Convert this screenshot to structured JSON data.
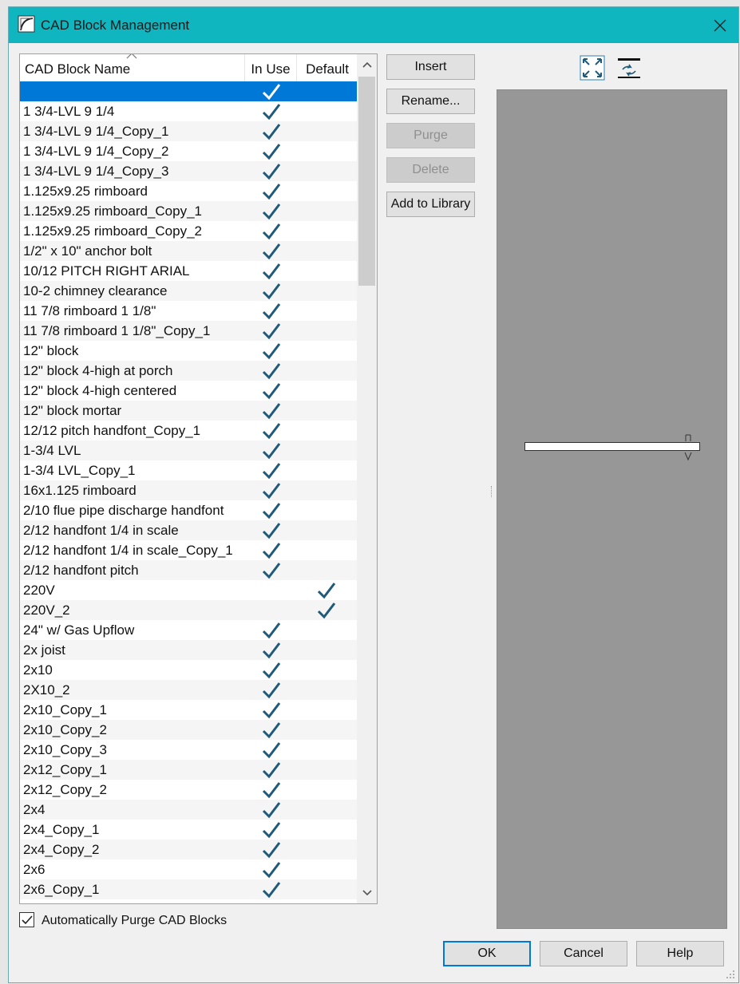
{
  "window": {
    "title": "CAD Block Management"
  },
  "columns": {
    "name": "CAD Block Name",
    "in_use": "In Use",
    "default": "Default"
  },
  "rows": [
    {
      "name": "",
      "in_use": true,
      "default": false,
      "selected": true
    },
    {
      "name": "1 3/4-LVL 9 1/4",
      "in_use": true,
      "default": false
    },
    {
      "name": "1 3/4-LVL 9 1/4_Copy_1",
      "in_use": true,
      "default": false
    },
    {
      "name": "1 3/4-LVL 9 1/4_Copy_2",
      "in_use": true,
      "default": false
    },
    {
      "name": "1 3/4-LVL 9 1/4_Copy_3",
      "in_use": true,
      "default": false
    },
    {
      "name": "1.125x9.25 rimboard",
      "in_use": true,
      "default": false
    },
    {
      "name": "1.125x9.25 rimboard_Copy_1",
      "in_use": true,
      "default": false
    },
    {
      "name": "1.125x9.25 rimboard_Copy_2",
      "in_use": true,
      "default": false
    },
    {
      "name": "1/2\" x 10\" anchor bolt",
      "in_use": true,
      "default": false
    },
    {
      "name": "10/12 PITCH RIGHT ARIAL",
      "in_use": true,
      "default": false
    },
    {
      "name": "10-2 chimney clearance",
      "in_use": true,
      "default": false
    },
    {
      "name": "11 7/8 rimboard 1 1/8\"",
      "in_use": true,
      "default": false
    },
    {
      "name": "11 7/8 rimboard 1 1/8\"_Copy_1",
      "in_use": true,
      "default": false
    },
    {
      "name": "12\" block",
      "in_use": true,
      "default": false
    },
    {
      "name": "12\" block 4-high at porch",
      "in_use": true,
      "default": false
    },
    {
      "name": "12\" block 4-high centered",
      "in_use": true,
      "default": false
    },
    {
      "name": "12\" block mortar",
      "in_use": true,
      "default": false
    },
    {
      "name": "12/12 pitch handfont_Copy_1",
      "in_use": true,
      "default": false
    },
    {
      "name": "1-3/4 LVL",
      "in_use": true,
      "default": false
    },
    {
      "name": "1-3/4 LVL_Copy_1",
      "in_use": true,
      "default": false
    },
    {
      "name": "16x1.125 rimboard",
      "in_use": true,
      "default": false
    },
    {
      "name": "2/10 flue pipe discharge handfont",
      "in_use": true,
      "default": false
    },
    {
      "name": "2/12 handfont 1/4 in scale",
      "in_use": true,
      "default": false
    },
    {
      "name": "2/12 handfont 1/4 in scale_Copy_1",
      "in_use": true,
      "default": false
    },
    {
      "name": "2/12 handfont pitch",
      "in_use": true,
      "default": false
    },
    {
      "name": "220V",
      "in_use": false,
      "default": true
    },
    {
      "name": "220V_2",
      "in_use": false,
      "default": true
    },
    {
      "name": "24\" w/ Gas Upflow",
      "in_use": true,
      "default": false
    },
    {
      "name": "2x joist",
      "in_use": true,
      "default": false
    },
    {
      "name": "2x10",
      "in_use": true,
      "default": false
    },
    {
      "name": "2X10_2",
      "in_use": true,
      "default": false
    },
    {
      "name": "2x10_Copy_1",
      "in_use": true,
      "default": false
    },
    {
      "name": "2x10_Copy_2",
      "in_use": true,
      "default": false
    },
    {
      "name": "2x10_Copy_3",
      "in_use": true,
      "default": false
    },
    {
      "name": "2x12_Copy_1",
      "in_use": true,
      "default": false
    },
    {
      "name": "2x12_Copy_2",
      "in_use": true,
      "default": false
    },
    {
      "name": "2x4",
      "in_use": true,
      "default": false
    },
    {
      "name": "2x4_Copy_1",
      "in_use": true,
      "default": false
    },
    {
      "name": "2x4_Copy_2",
      "in_use": true,
      "default": false
    },
    {
      "name": "2x6",
      "in_use": true,
      "default": false
    },
    {
      "name": "2x6_Copy_1",
      "in_use": true,
      "default": false
    }
  ],
  "buttons": {
    "insert": "Insert",
    "rename": "Rename...",
    "purge": "Purge",
    "delete": "Delete",
    "add_to_library": "Add to Library"
  },
  "auto_purge": {
    "label": "Automatically Purge CAD Blocks",
    "checked": true
  },
  "footer": {
    "ok": "OK",
    "cancel": "Cancel",
    "help": "Help"
  },
  "colors": {
    "titlebar": "#0fb6c0",
    "selection": "#0078d7",
    "checkmark": "#1f5a7a",
    "preview_bg": "#979797"
  },
  "icons": {
    "fit": "fit-to-window-icon",
    "swap": "rotate-view-icon"
  }
}
